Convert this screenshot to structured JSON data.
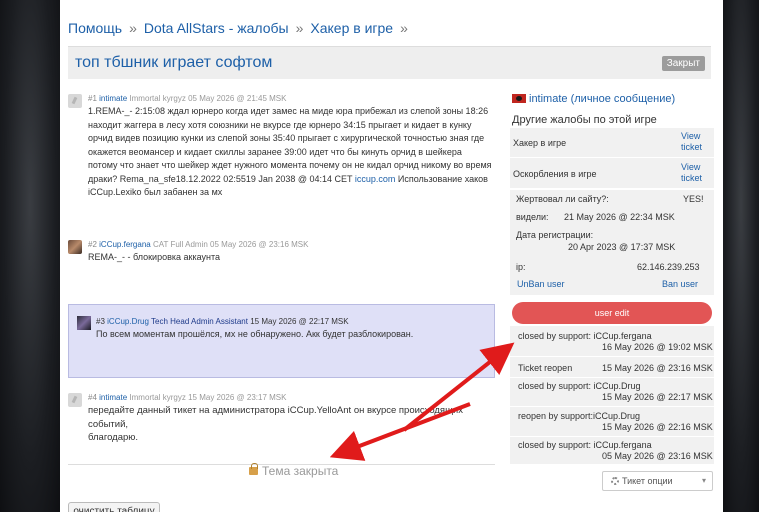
{
  "breadcrumb": {
    "items": [
      "Помощь",
      "Dota AllStars - жалобы",
      "Хакер в игре"
    ],
    "sep": "»"
  },
  "topic": {
    "title": "топ тбшник играет софтом",
    "status_badge": "Закрыт"
  },
  "posts": [
    {
      "num": "#1",
      "user": "intimate",
      "rank": "Immortal kyrgyz",
      "date": "05 May 2026 @ 21:45 MSK",
      "lines": [
        "1.REMA-_- 2:15:08 ждал юрнеро когда идет замес на миде юра прибежал из слепой зоны 18:26",
        "находит жаггера в лесу хотя союзники не вкурсе где юрнеро 34:15 прыгает и кидает в кунку",
        "орчид видев позицию кунки из слепой зоны 35:40 прыгает с хирургической точностью зная где",
        "окажется веомансер и кидает скиллы заранее 39:00 идет что бы кинуть орчид в шейкера",
        "потому что знает что шейкер ждет нужного момента почему он не кидал орчид никому во время",
        "драки? Rema_na_sfe18.12.2022 02:5519 Jan 2038 @ 04:14 CET",
        "iCCup.Lexiko был забанен за мх"
      ],
      "link": "iccup.com",
      "after_link": " Использование хаков"
    },
    {
      "num": "#2",
      "user": "iCCup.fergana",
      "rank": "CAT Full Admin",
      "date": "05 May 2026 @ 23:16 MSK",
      "text": "REMA-_- - блокировка аккаунта"
    },
    {
      "num": "#3",
      "user": "iCCup.Drug",
      "rank": "Tech Head Admin Assistant",
      "date": "15 May 2026 @ 22:17 MSK",
      "text": "По всем моментам прошёлся, мх не обнаружено. Акк будет разблокирован."
    },
    {
      "num": "#4",
      "user": "intimate",
      "rank": "Immortal kyrgyz",
      "date": "15 May 2026 @ 23:17 MSK",
      "line1": "передайте данный тикет на администратора iCCup.YelloAnt он вкурсе происходящих событий,",
      "line2": "благодарю."
    }
  ],
  "locked_text": "Тема закрыта",
  "clear_button": "очистить таблицу",
  "sidebar": {
    "user": "intimate",
    "pm": "(личное сообщение)",
    "heading": "Другие жалобы по этой игре",
    "complaints": [
      {
        "label": "Хакер в игре",
        "view1": "View",
        "view2": "ticket"
      },
      {
        "label": "Оскорбления в игре",
        "view1": "View",
        "view2": "ticket"
      }
    ],
    "info": {
      "donated_label": "Жертвовал ли сайту?:",
      "donated_value": "YES!",
      "seen_label": "видели:",
      "seen_value": "21 May 2026 @ 22:34 MSK",
      "reg_label": "Дата регистрации:",
      "reg_value": "20 Apr 2023 @ 17:37 MSK",
      "ip_label": "ip:",
      "ip_value": "62.146.239.253",
      "unban": "UnBan user",
      "ban": "Ban user"
    },
    "user_edit": "user edit",
    "log": [
      {
        "action": "closed by support: iCCup.fergana",
        "date": "16 May 2026 @ 19:02 MSK"
      },
      {
        "action": "Ticket reopen",
        "date": "15 May 2026 @ 23:16 MSK"
      },
      {
        "action": "closed by support: iCCup.Drug",
        "date": "15 May 2026 @ 22:17 MSK"
      },
      {
        "action": "reopen by support:iCCup.Drug",
        "date": "15 May 2026 @ 22:16 MSK"
      },
      {
        "action": "closed by support: iCCup.fergana",
        "date": "05 May 2026 @ 23:16 MSK"
      }
    ],
    "ticket_options": "Тикет опции"
  }
}
